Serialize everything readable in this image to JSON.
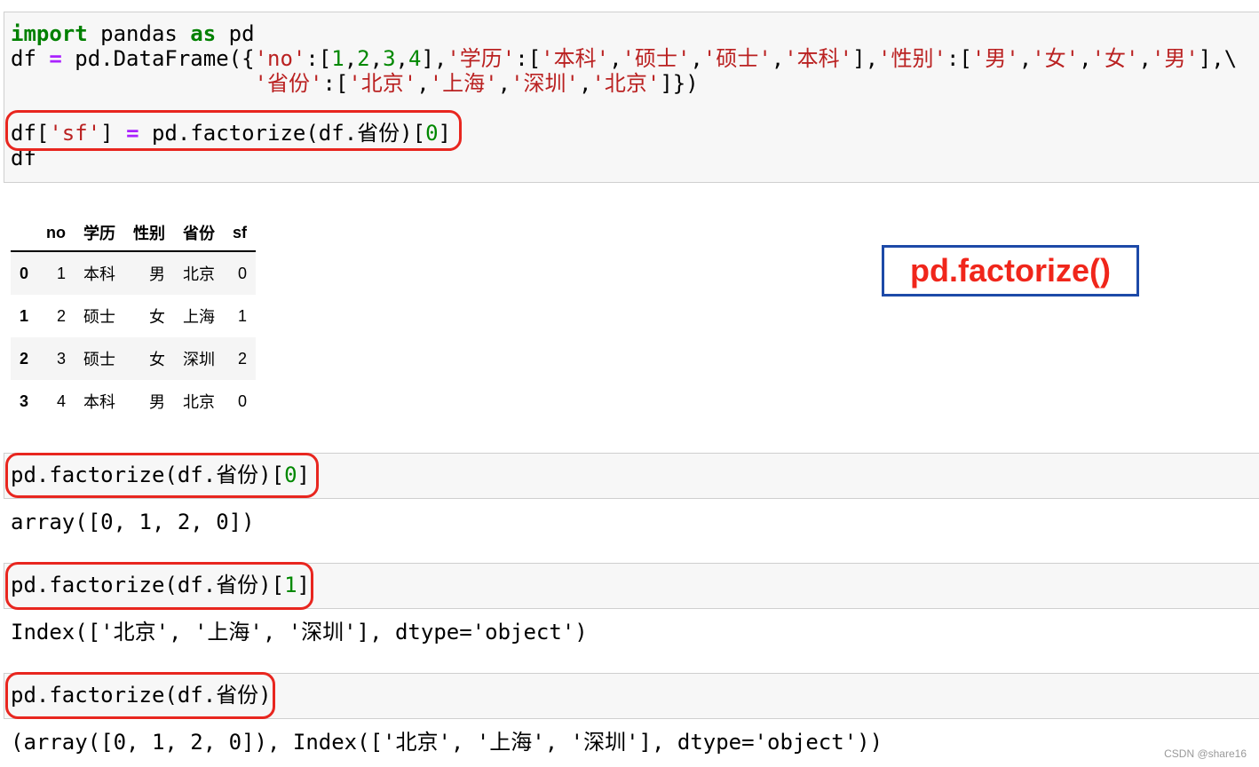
{
  "cells": [
    {
      "lines": [
        [
          [
            "import",
            "kw"
          ],
          [
            " pandas ",
            ""
          ],
          [
            "as",
            "kw"
          ],
          [
            " pd",
            ""
          ]
        ],
        [
          [
            "df ",
            ""
          ],
          [
            "=",
            "op"
          ],
          [
            " pd.DataFrame({",
            ""
          ],
          [
            "'no'",
            "str"
          ],
          [
            ":[",
            ""
          ],
          [
            "1",
            "num"
          ],
          [
            ",",
            ""
          ],
          [
            "2",
            "num"
          ],
          [
            ",",
            ""
          ],
          [
            "3",
            "num"
          ],
          [
            ",",
            ""
          ],
          [
            "4",
            "num"
          ],
          [
            "],",
            ""
          ],
          [
            "'学历'",
            "str"
          ],
          [
            ":[",
            ""
          ],
          [
            "'本科'",
            "str"
          ],
          [
            ",",
            ""
          ],
          [
            "'硕士'",
            "str"
          ],
          [
            ",",
            ""
          ],
          [
            "'硕士'",
            "str"
          ],
          [
            ",",
            ""
          ],
          [
            "'本科'",
            "str"
          ],
          [
            "],",
            ""
          ],
          [
            "'性别'",
            "str"
          ],
          [
            ":[",
            ""
          ],
          [
            "'男'",
            "str"
          ],
          [
            ",",
            ""
          ],
          [
            "'女'",
            "str"
          ],
          [
            ",",
            ""
          ],
          [
            "'女'",
            "str"
          ],
          [
            ",",
            ""
          ],
          [
            "'男'",
            "str"
          ],
          [
            "],\\",
            ""
          ]
        ],
        [
          [
            "                   ",
            ""
          ],
          [
            "'省份'",
            "str"
          ],
          [
            ":[",
            ""
          ],
          [
            "'北京'",
            "str"
          ],
          [
            ",",
            ""
          ],
          [
            "'上海'",
            "str"
          ],
          [
            ",",
            ""
          ],
          [
            "'深圳'",
            "str"
          ],
          [
            ",",
            ""
          ],
          [
            "'北京'",
            "str"
          ],
          [
            "]})",
            ""
          ]
        ],
        [
          [
            "",
            ""
          ]
        ],
        [
          [
            "df[",
            ""
          ],
          [
            "'sf'",
            "str"
          ],
          [
            "] ",
            ""
          ],
          [
            "=",
            "op"
          ],
          [
            " pd.factorize(df.省份)[",
            ""
          ],
          [
            "0",
            "num"
          ],
          [
            "]",
            ""
          ]
        ],
        [
          [
            "df",
            ""
          ]
        ]
      ]
    },
    {
      "lines": [
        [
          [
            "pd.factorize(df.省份)[",
            ""
          ],
          [
            "0",
            "num"
          ],
          [
            "]",
            ""
          ]
        ]
      ],
      "output": "array([0, 1, 2, 0])"
    },
    {
      "lines": [
        [
          [
            "pd.factorize(df.省份)[",
            ""
          ],
          [
            "1",
            "num"
          ],
          [
            "]",
            ""
          ]
        ]
      ],
      "output": "Index(['北京', '上海', '深圳'], dtype='object')"
    },
    {
      "lines": [
        [
          [
            "pd.factorize(df.省份)",
            ""
          ]
        ]
      ],
      "output": "(array([0, 1, 2, 0]), Index(['北京', '上海', '深圳'], dtype='object'))"
    }
  ],
  "table": {
    "columns": [
      "",
      "no",
      "学历",
      "性别",
      "省份",
      "sf"
    ],
    "rows": [
      [
        "0",
        "1",
        "本科",
        "男",
        "北京",
        "0"
      ],
      [
        "1",
        "2",
        "硕士",
        "女",
        "上海",
        "1"
      ],
      [
        "2",
        "3",
        "硕士",
        "女",
        "深圳",
        "2"
      ],
      [
        "3",
        "4",
        "本科",
        "男",
        "北京",
        "0"
      ]
    ]
  },
  "annotation": "pd.factorize()",
  "watermark": "CSDN @share16",
  "colors": {
    "highlight": "#e8261f",
    "annotation_border": "#1d4aa8",
    "annotation_text": "#f0261b"
  }
}
